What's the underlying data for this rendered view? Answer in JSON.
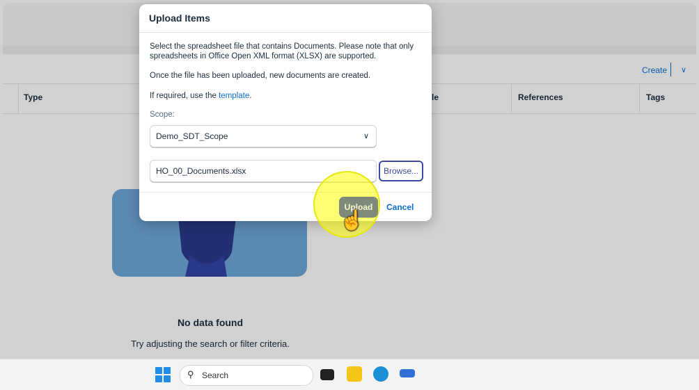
{
  "toolbar": {
    "create_label": "Create"
  },
  "table": {
    "columns": [
      "Type",
      "le",
      "References",
      "Tags"
    ]
  },
  "empty_state": {
    "title": "No data found",
    "hint": "Try adjusting the search or filter criteria."
  },
  "dialog": {
    "title": "Upload Items",
    "line1": "Select the spreadsheet file that contains Documents. Please note that only spreadsheets in Office Open XML format (XLSX) are supported.",
    "line2": "Once the file has been uploaded, new documents are created.",
    "template_prefix": "If required, use the",
    "template_link": "template",
    "template_suffix": ".",
    "scope_label": "Scope:",
    "scope_value": "Demo_SDT_Scope",
    "file_value": "HO_00_Documents.xlsx",
    "browse_label": "Browse...",
    "upload_label": "Upload",
    "cancel_label": "Cancel"
  },
  "taskbar": {
    "search_placeholder": "Search"
  },
  "colors": {
    "accent": "#0a6ed1",
    "highlight": "#ffff00"
  }
}
